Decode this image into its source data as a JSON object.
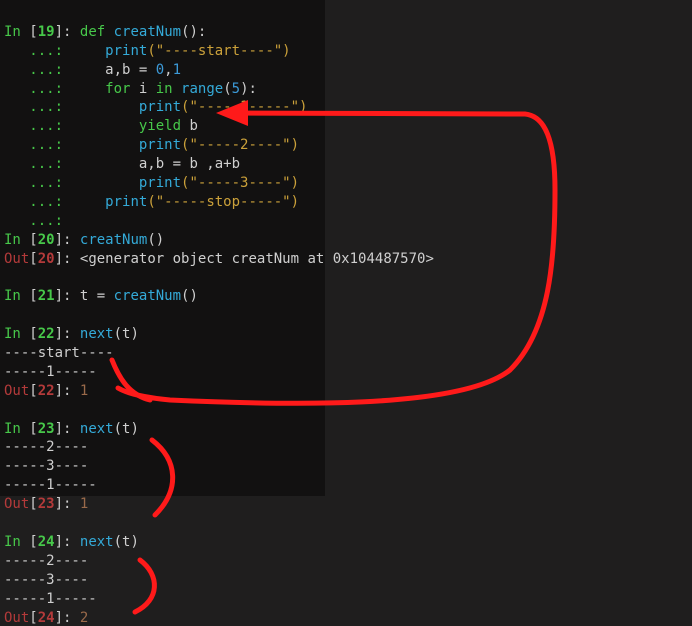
{
  "cells": {
    "c19": {
      "in_num": "19",
      "code": {
        "def": "def",
        "fn": "creatNum",
        "sig": "():",
        "l1a": "print",
        "l1b": "(\"----start----\")",
        "l2": "a,b = ",
        "l2n0": "0",
        "l2c": ",",
        "l2n1": "1",
        "l3for": "for",
        "l3var": " i ",
        "l3in": "in",
        "l3sp": " ",
        "l3range": "range",
        "l3p": "(",
        "l3n": "5",
        "l3e": "):",
        "l4a": "print",
        "l4b": "(\"-----1-----\")",
        "l5y": "yield",
        "l5b": " b",
        "l6a": "print",
        "l6b": "(\"-----2----\")",
        "l7": "a,b = b ,a+b",
        "l8a": "print",
        "l8b": "(\"-----3----\")",
        "l9a": "print",
        "l9b": "(\"-----stop-----\")"
      }
    },
    "c20": {
      "in_num": "20",
      "code": "creatNum",
      "paren": "()",
      "out_num": "20",
      "out_val": "<generator object creatNum at 0x104487570>"
    },
    "c21": {
      "in_num": "21",
      "code_pre": "t = ",
      "code_fn": "creatNum",
      "code_post": "()"
    },
    "c22": {
      "in_num": "22",
      "code_fn": "next",
      "code_arg": "(t)",
      "stdout": [
        "----start----",
        "-----1-----"
      ],
      "out_num": "22",
      "out_val": "1"
    },
    "c23": {
      "in_num": "23",
      "code_fn": "next",
      "code_arg": "(t)",
      "stdout": [
        "-----2----",
        "-----3----",
        "-----1-----"
      ],
      "out_num": "23",
      "out_val": "1"
    },
    "c24": {
      "in_num": "24",
      "code_fn": "next",
      "code_arg": "(t)",
      "stdout": [
        "-----2----",
        "-----3----",
        "-----1-----"
      ],
      "out_num": "24",
      "out_val": "2"
    }
  },
  "labels": {
    "in": "In",
    "out": "Out",
    "dots": "   ...: "
  }
}
